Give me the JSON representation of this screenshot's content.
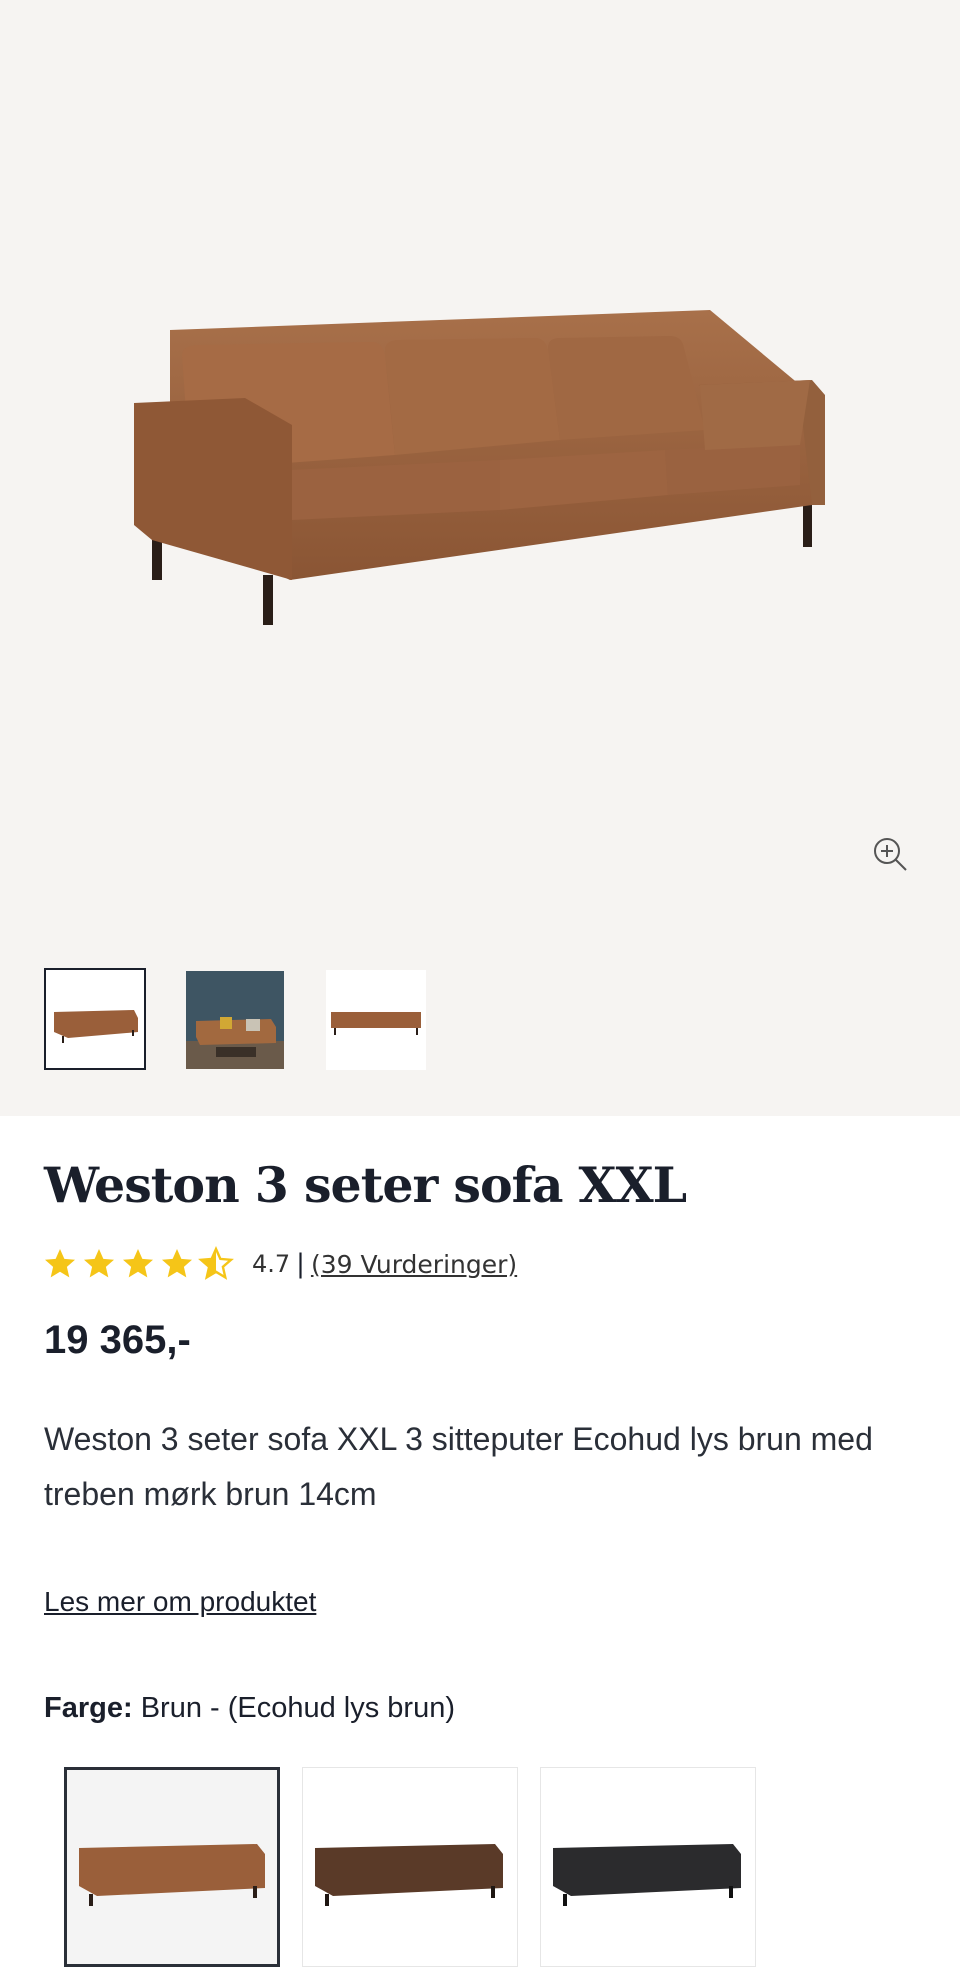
{
  "product": {
    "title": "Weston 3 seter sofa XXL",
    "rating_value": "4.7",
    "rating_stars": 4.7,
    "rating_separator": "|",
    "reviews_link": "(39 Vurderinger)",
    "price": "19 365,-",
    "description": "Weston 3 seter sofa XXL 3 sitteputer Ecohud lys brun med treben mørk brun 14cm",
    "read_more": "Les mer om produktet",
    "color_label": "Farge:",
    "color_value": "Brun - (Ecohud lys brun)"
  },
  "gallery": {
    "zoom_icon": "zoom-in-icon",
    "thumbnails": [
      "sofa-front",
      "sofa-room-scene",
      "sofa-side"
    ]
  },
  "swatches": [
    {
      "name": "Ecohud lys brun",
      "color": "#9a5f3a",
      "selected": true
    },
    {
      "name": "mørk brun",
      "color": "#5a3a28",
      "selected": false
    },
    {
      "name": "sort",
      "color": "#2b2b2d",
      "selected": false
    }
  ],
  "colors": {
    "star": "#f5c518",
    "text": "#1a1f2b",
    "gallery_bg": "#f6f4f2"
  }
}
